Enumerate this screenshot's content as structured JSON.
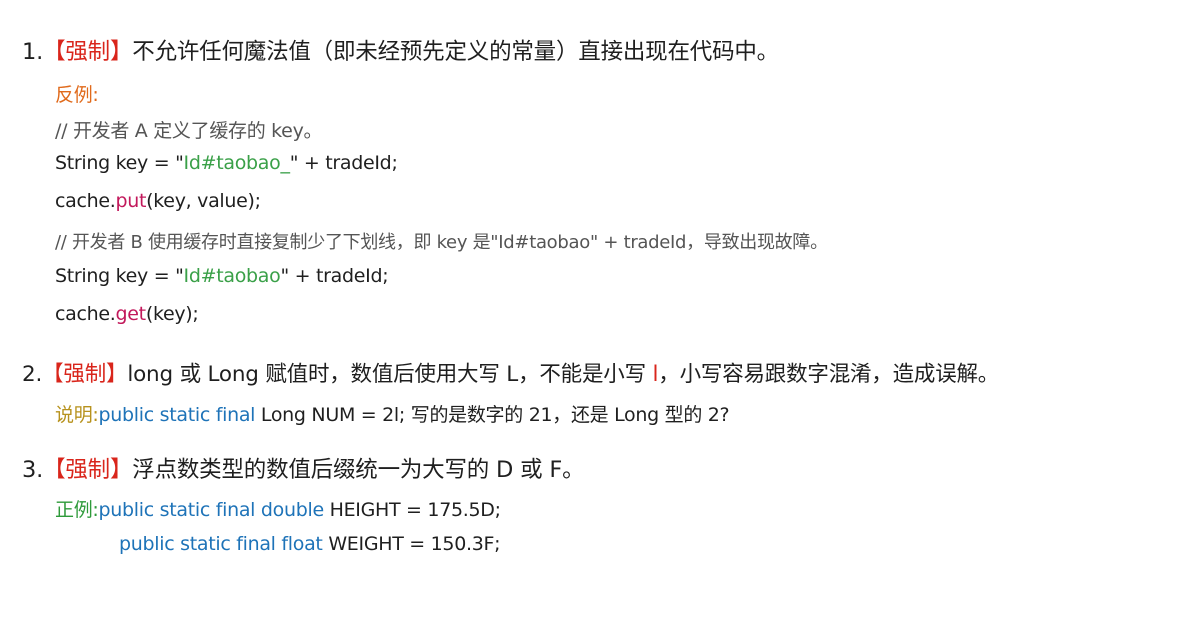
{
  "rules": [
    {
      "number": "1.",
      "tag": "【强制】",
      "text": "不允许任何魔法值（即未经预先定义的常量）直接出现在代码中。",
      "label": "反例:",
      "lines": {
        "c1": "//  开发者 A 定义了缓存的 key。",
        "l2_pre": "String key = \"",
        "l2_str": "Id#taobao_",
        "l2_post": "\" + tradeId;",
        "l3_pre": "cache.",
        "l3_meth": "put",
        "l3_post": "(key, value);",
        "c2": "// 开发者 B 使用缓存时直接复制少了下划线，即 key 是\"Id#taobao\" + tradeId，导致出现故障。",
        "l5_pre": "String key = \"",
        "l5_str": "Id#taobao",
        "l5_post": "\" + tradeId;",
        "l6_pre": "cache.",
        "l6_meth": "get",
        "l6_post": "(key);"
      }
    },
    {
      "number": "2.",
      "tag": "【强制】",
      "text_a": "long 或 Long 赋值时，数值后使用大写 L，不能是小写 ",
      "text_red": "l",
      "text_b": "，小写容易跟数字混淆，造成误解。",
      "label": "说明:",
      "kw": "public static final",
      "rest": " Long NUM = 2l; 写的是数字的 21，还是 Long 型的 2?"
    },
    {
      "number": "3.",
      "tag": "【强制】",
      "text": "浮点数类型的数值后缀统一为大写的 D 或 F。",
      "label": "正例:",
      "kw1": "public static final double",
      "rest1": " HEIGHT = 175.5D;",
      "kw2": "public static final float",
      "rest2": " WEIGHT = 150.3F;"
    }
  ]
}
